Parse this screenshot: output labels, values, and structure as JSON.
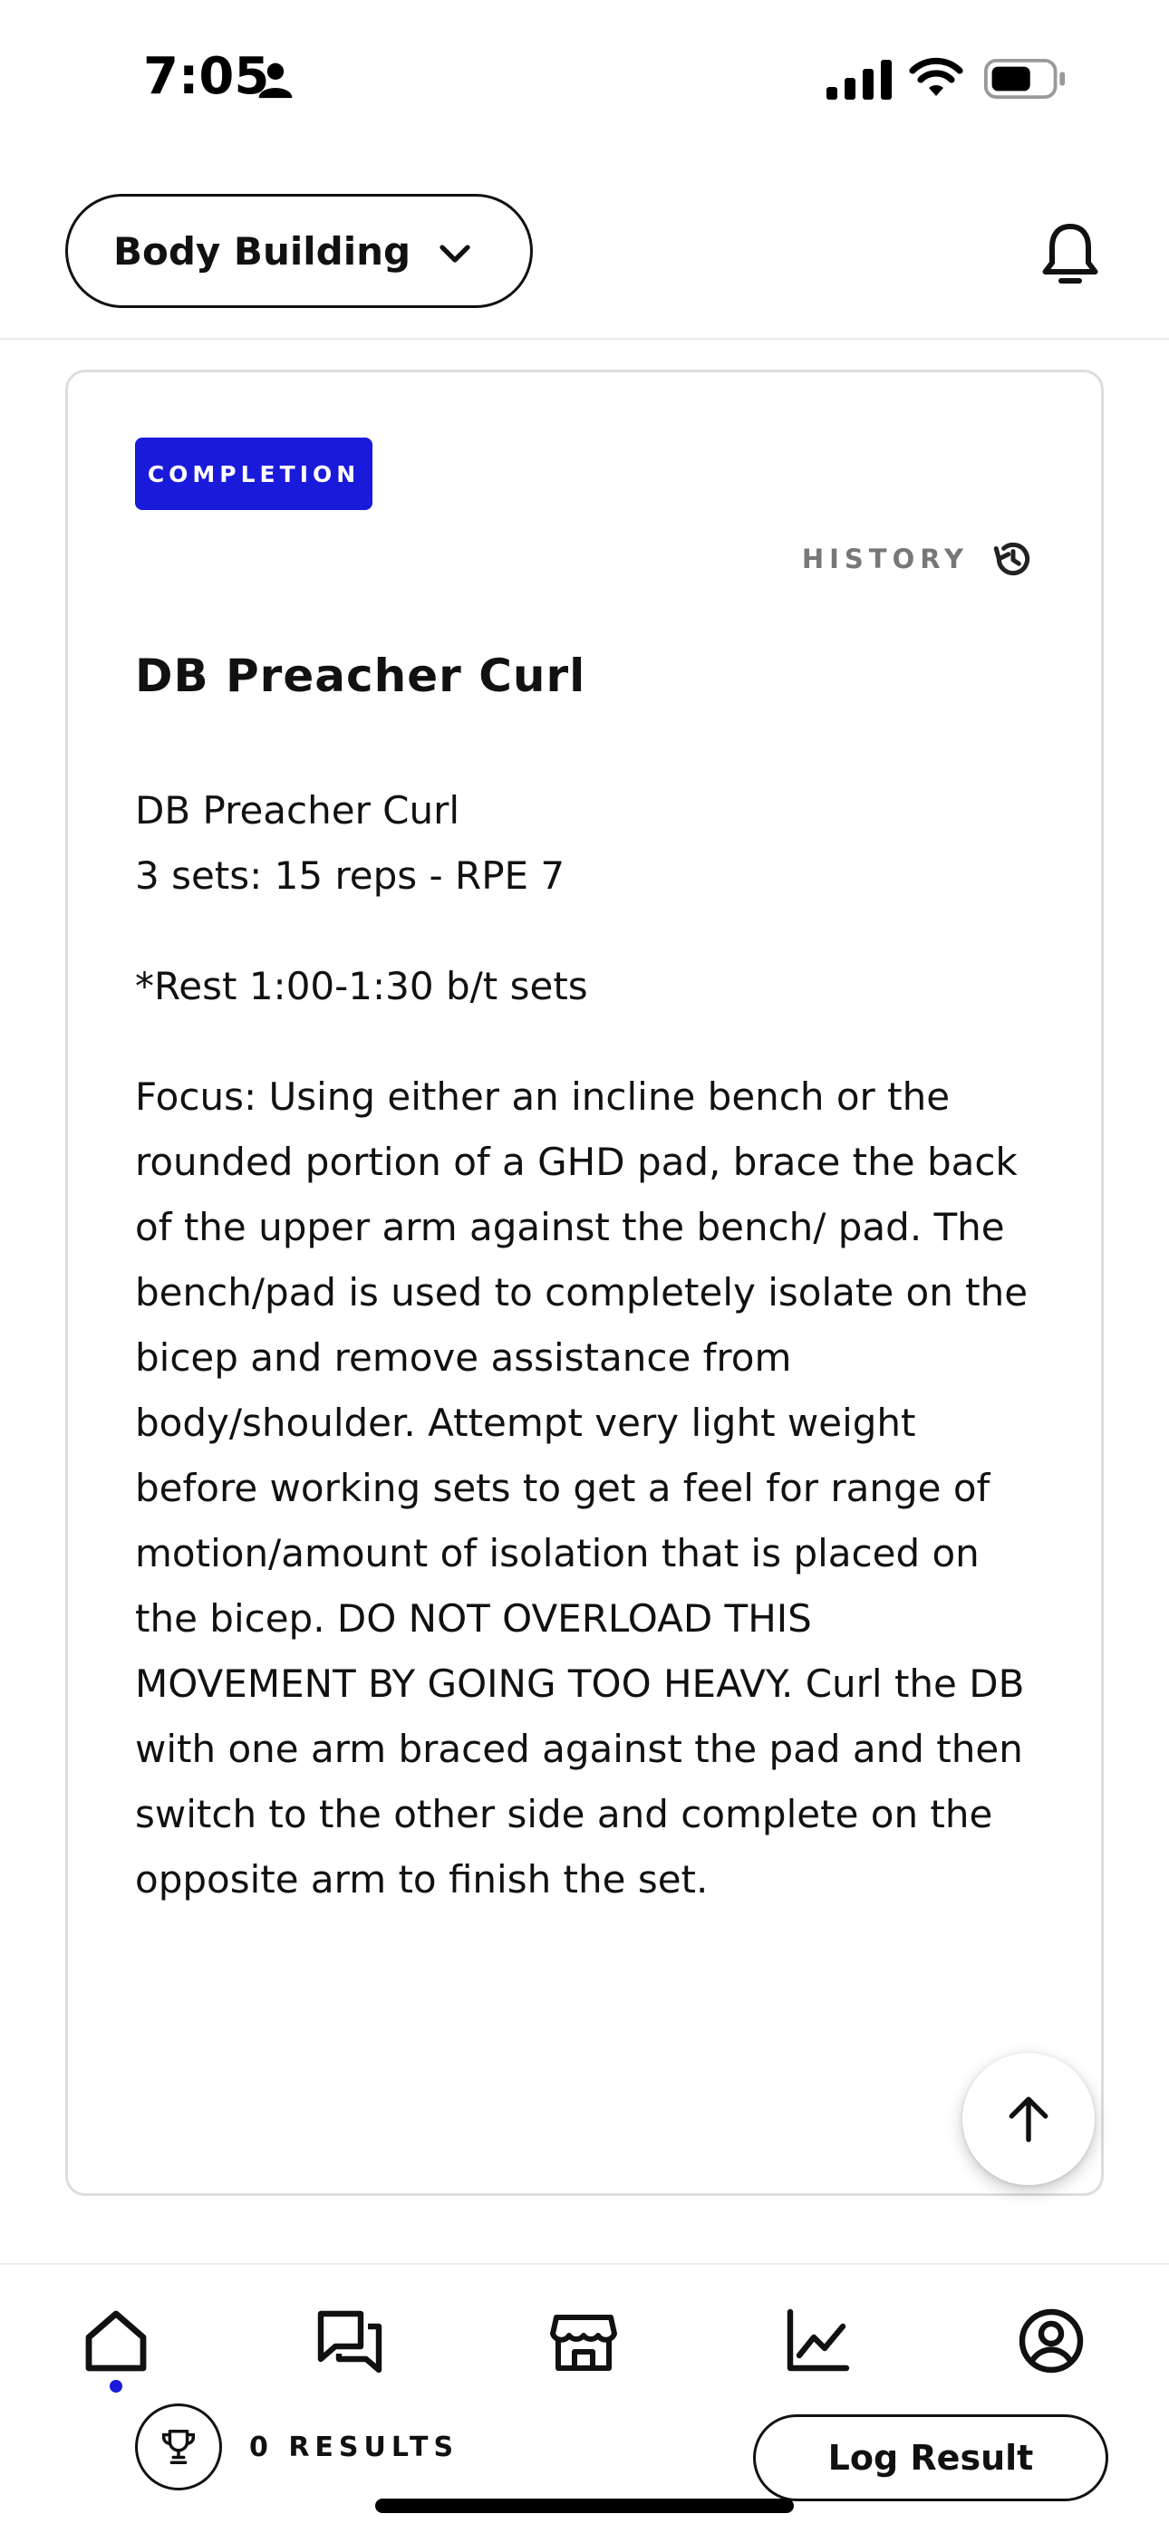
{
  "status_bar": {
    "time": "7:05"
  },
  "header": {
    "program_select": "Body Building"
  },
  "card": {
    "badge": "COMPLETION",
    "history_label": "HISTORY",
    "title": "DB Preacher Curl",
    "line1": "DB Preacher Curl",
    "line2": "3 sets: 15 reps - RPE 7",
    "line3": "*Rest 1:00-1:30 b/t sets",
    "focus": "Focus: Using either an incline bench or the rounded portion of a GHD pad, brace the back of the upper arm against the bench/ pad. The bench/pad is used to completely isolate on the bicep and remove assistance from body/shoulder. Attempt very light weight before working sets to get a feel for range of motion/amount of isolation that is placed on the bicep. DO NOT OVERLOAD THIS MOVEMENT BY GOING TOO HEAVY. Curl the DB with one arm braced against the pad and then switch to the other side and complete on the opposite arm to finish the set.",
    "results_label": "0 RESULTS",
    "log_button": "Log Result"
  },
  "colors": {
    "accent": "#1a1adb",
    "border": "#dddddd",
    "muted_text": "#777777"
  },
  "icons": {
    "status": [
      "person-icon",
      "signal-icon",
      "wifi-icon",
      "battery-icon"
    ],
    "header": [
      "chevron-down-icon",
      "bell-icon"
    ],
    "card": [
      "history-icon",
      "trophy-icon",
      "arrow-up-icon"
    ],
    "tabs": [
      "home-icon",
      "chat-icon",
      "store-icon",
      "chart-icon",
      "profile-icon"
    ]
  },
  "tabs": {
    "active": "home"
  }
}
